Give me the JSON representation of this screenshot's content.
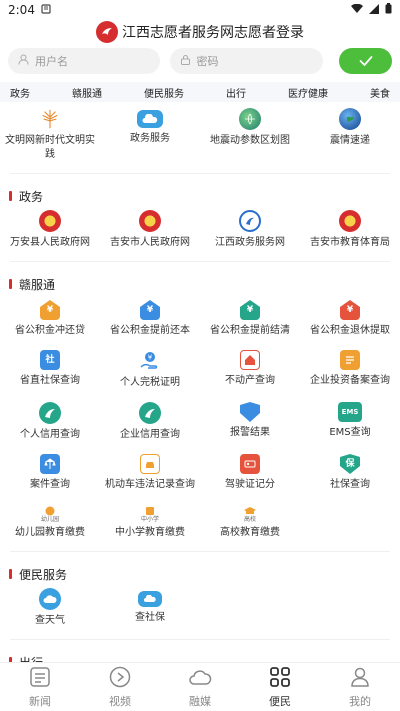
{
  "status": {
    "time": "2:04"
  },
  "header": {
    "title": "江西志愿者服务网志愿者登录"
  },
  "login": {
    "username_placeholder": "用户名",
    "password_placeholder": "密码"
  },
  "category_tabs": [
    "政务",
    "赣服通",
    "便民服务",
    "出行",
    "医疗健康",
    "美食"
  ],
  "top_items": [
    {
      "label": "文明网新时代文明实践",
      "icon": "tree-icon"
    },
    {
      "label": "政务服务",
      "icon": "cloud-icon"
    },
    {
      "label": "地震动参数区划图",
      "icon": "globe-icon"
    },
    {
      "label": "震情速递",
      "icon": "earth-icon"
    }
  ],
  "sections": {
    "zhengwu": {
      "title": "政务",
      "items": [
        {
          "label": "万安县人民政府网",
          "icon": "emblem-icon"
        },
        {
          "label": "吉安市人民政府网",
          "icon": "emblem-icon"
        },
        {
          "label": "江西政务服务网",
          "icon": "jiangxi-gov-icon"
        },
        {
          "label": "吉安市教育体育局",
          "icon": "emblem-icon"
        }
      ]
    },
    "ganfutong": {
      "title": "赣服通",
      "items": [
        {
          "label": "省公积金冲还贷",
          "icon": "fund-icon"
        },
        {
          "label": "省公积金提前还本",
          "icon": "fund-icon"
        },
        {
          "label": "省公积金提前结清",
          "icon": "fund-icon"
        },
        {
          "label": "省公积金退休提取",
          "icon": "fund-icon"
        },
        {
          "label": "省直社保查询",
          "icon": "social-security-icon",
          "text": "社"
        },
        {
          "label": "个人完税证明",
          "icon": "hand-icon"
        },
        {
          "label": "不动产查询",
          "icon": "house-icon"
        },
        {
          "label": "企业投资备案查询",
          "icon": "document-icon"
        },
        {
          "label": "个人信用查询",
          "icon": "credit-icon"
        },
        {
          "label": "企业信用查询",
          "icon": "credit-icon"
        },
        {
          "label": "报警结果",
          "icon": "shield-icon"
        },
        {
          "label": "EMS查询",
          "icon": "ems-icon",
          "text": "EMS"
        },
        {
          "label": "案件查询",
          "icon": "case-icon"
        },
        {
          "label": "机动车违法记录查询",
          "icon": "car-icon"
        },
        {
          "label": "驾驶证记分",
          "icon": "license-icon"
        },
        {
          "label": "社保查询",
          "icon": "social-shield-icon",
          "text": "保"
        }
      ]
    },
    "education": {
      "items": [
        {
          "label": "幼儿园教育缴费",
          "icon": "kindergarten-icon",
          "tag": "幼儿园"
        },
        {
          "label": "中小学教育缴费",
          "icon": "school-icon",
          "tag": "中小学"
        },
        {
          "label": "高校教育缴费",
          "icon": "college-icon",
          "tag": "高校"
        }
      ]
    },
    "bianmin": {
      "title": "便民服务",
      "items": [
        {
          "label": "查天气",
          "icon": "weather-icon"
        },
        {
          "label": "查社保",
          "icon": "social-query-icon"
        }
      ]
    },
    "chuxing": {
      "title": "出行"
    }
  },
  "bottom_tabs": [
    {
      "label": "新闻",
      "icon": "news-icon"
    },
    {
      "label": "视频",
      "icon": "play-icon"
    },
    {
      "label": "融媒",
      "icon": "cloud-media-icon"
    },
    {
      "label": "便民",
      "icon": "grid-icon",
      "active": true
    },
    {
      "label": "我的",
      "icon": "user-icon"
    }
  ],
  "colors": {
    "accent_green": "#4cbe3b",
    "section_red": "#d62e2e",
    "fund_orange": "#f0a030",
    "fund_teal": "#25a58a",
    "fund_red": "#e5533d",
    "blue": "#3a8de0"
  }
}
